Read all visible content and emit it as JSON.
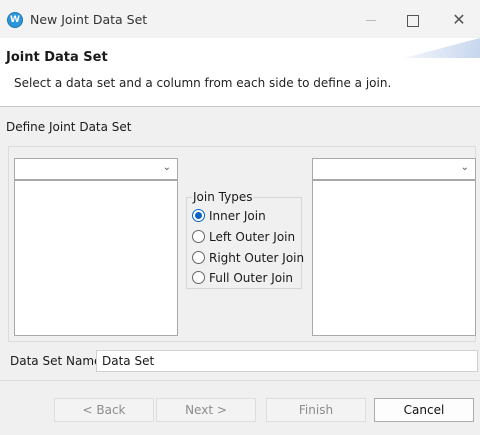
{
  "window": {
    "title": "New Joint Data Set",
    "controls": {
      "minimize": "—",
      "maximize": "☐",
      "close": "✕"
    }
  },
  "header": {
    "title": "Joint Data Set",
    "description": "Select a data set and a column from each side to define a join."
  },
  "form": {
    "section_label": "Define Joint Data Set",
    "left_dataset": {
      "value": ""
    },
    "right_dataset": {
      "value": ""
    },
    "join_types": {
      "legend": "Join Types",
      "options": [
        "Inner Join",
        "Left Outer Join",
        "Right Outer Join",
        "Full Outer Join"
      ],
      "selected": "Inner Join"
    },
    "data_set_name": {
      "label": "Data Set Name:",
      "value": "Data Set"
    }
  },
  "buttons": {
    "back": "< Back",
    "next": "Next >",
    "finish": "Finish",
    "cancel": "Cancel"
  },
  "icons": {
    "app": "eclipse-birt-icon",
    "dropdown": "chevron-down-icon"
  },
  "colors": {
    "radio_checked": "#0b62c4",
    "header_bg": "#ffffff",
    "dialog_bg": "#f0f0f0"
  }
}
